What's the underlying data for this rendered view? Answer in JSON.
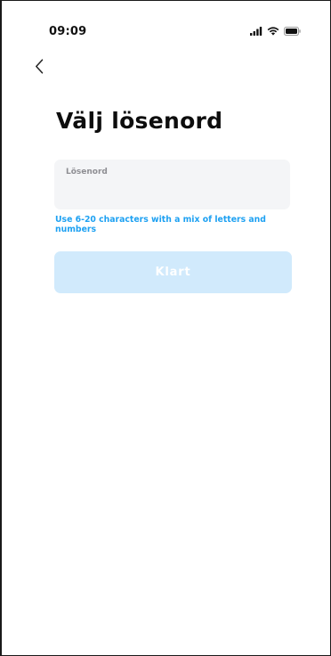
{
  "status_bar": {
    "time": "09:09",
    "icons": [
      "signal-icon",
      "wifi-icon",
      "battery-icon"
    ]
  },
  "nav": {
    "back_icon": "chevron-left-icon"
  },
  "page": {
    "title": "Välj lösenord"
  },
  "password_field": {
    "label": "Lösenord",
    "value": "",
    "placeholder": ""
  },
  "hint": {
    "text": "Use 6-20 characters with a mix of letters and numbers"
  },
  "done_button": {
    "label": "Klart",
    "enabled": false
  },
  "colors": {
    "accent": "#1ea1f2",
    "button_disabled_bg": "#d1eafc",
    "field_bg": "#f4f5f7",
    "title_text": "#0d0d0d",
    "label_text": "#8e8e93"
  }
}
